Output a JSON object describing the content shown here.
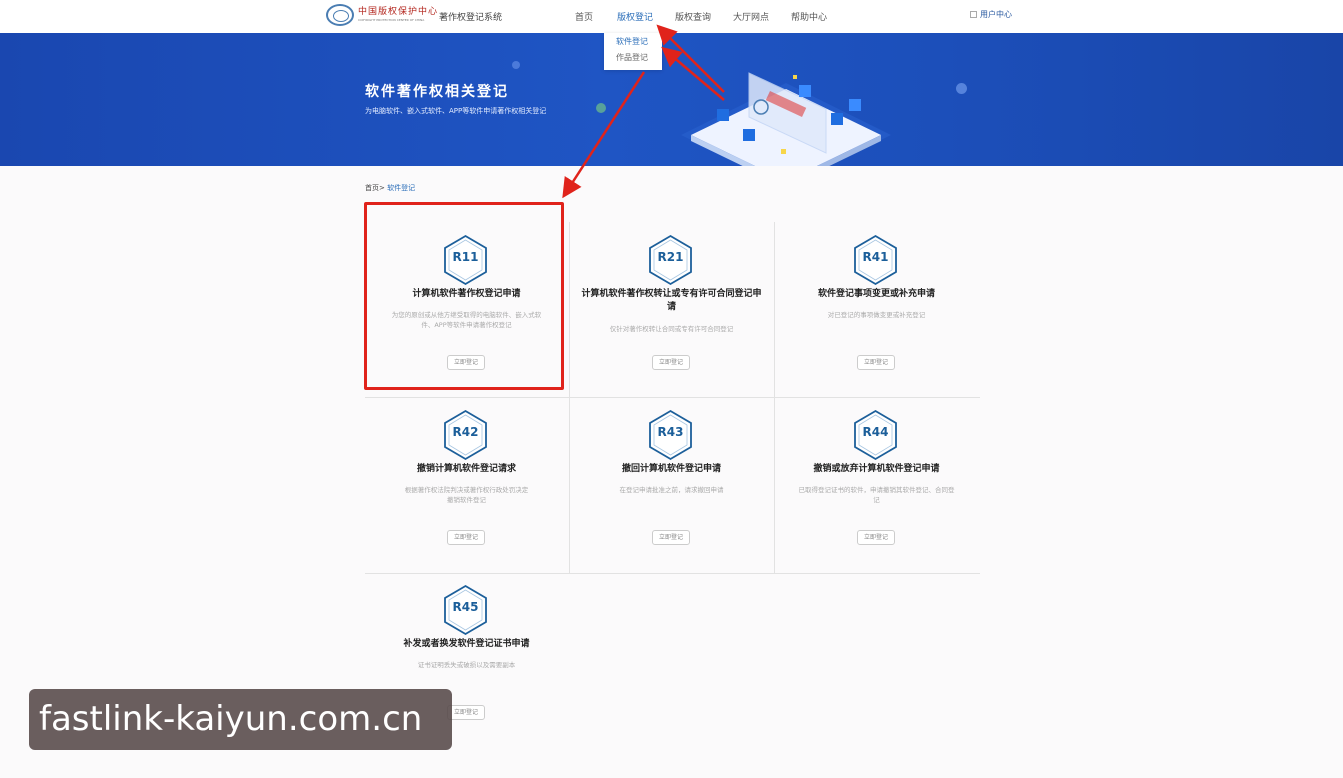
{
  "header": {
    "logo_cn": "中国版权保护中心",
    "logo_en": "COPYRIGHT PROTECTION CENTER OF CHINA",
    "system_name": "著作权登记系统",
    "nav": [
      {
        "label": "首页"
      },
      {
        "label": "版权登记"
      },
      {
        "label": "版权查询"
      },
      {
        "label": "大厅网点"
      },
      {
        "label": "帮助中心"
      }
    ],
    "user_center": "用户中心"
  },
  "dropdown": {
    "items": [
      {
        "label": "软件登记"
      },
      {
        "label": "作品登记"
      }
    ]
  },
  "banner": {
    "title": "软件著作权相关登记",
    "subtitle": "为电脑软件、嵌入式软件、APP等软件申请著作权相关登记"
  },
  "breadcrumb": {
    "home": "首页>",
    "current": "软件登记"
  },
  "cards": [
    {
      "code": "R11",
      "title": "计算机软件著作权登记申请",
      "desc": "为您的原创或从他方继受取得的电脑软件、嵌入式软件、APP等软件申请著作权登记",
      "button": "立即登记"
    },
    {
      "code": "R21",
      "title": "计算机软件著作权转让或专有许可合同登记申请",
      "desc": "仅针对著作权转让合同或专有许可合同登记",
      "button": "立即登记"
    },
    {
      "code": "R41",
      "title": "软件登记事项变更或补充申请",
      "desc": "对已登记的事项做变更或补充登记",
      "button": "立即登记"
    },
    {
      "code": "R42",
      "title": "撤销计算机软件登记请求",
      "desc": "根据著作权法院判决或著作权行政处罚决定撤销软件登记",
      "button": "立即登记"
    },
    {
      "code": "R43",
      "title": "撤回计算机软件登记申请",
      "desc": "在登记申请批准之前，请求撤回申请",
      "button": "立即登记"
    },
    {
      "code": "R44",
      "title": "撤销或放弃计算机软件登记申请",
      "desc": "已取得登记证书的软件，申请撤销其软件登记、合同登记",
      "button": "立即登记"
    },
    {
      "code": "R45",
      "title": "补发或者换发软件登记证书申请",
      "desc": "证书证明丢失或破损以及需要副本",
      "button": "立即登记"
    }
  ],
  "watermark": "fastlink-kaiyun.com.cn",
  "colors": {
    "accent": "#2a6db8",
    "banner": "#1f55c4",
    "highlight": "#e0231b",
    "hex_code": "#1c5f9a"
  }
}
